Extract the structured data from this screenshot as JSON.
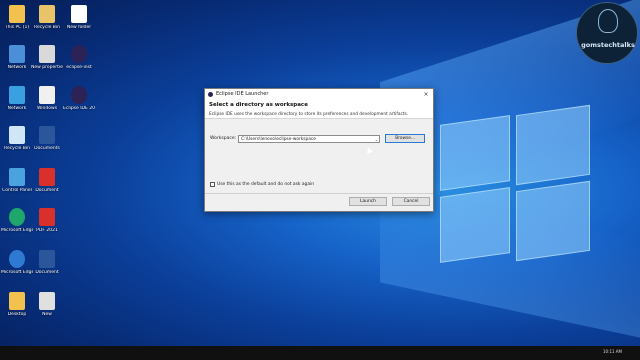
{
  "desktop": {
    "icons": [
      {
        "label": "This PC (1)",
        "color": "#f2c14e"
      },
      {
        "label": "Recycle Bin",
        "color": "#e8c36a"
      },
      {
        "label": "New folder",
        "color": "#ffffff"
      },
      {
        "label": "Network",
        "color": "#4a8fd8"
      },
      {
        "label": "New properties",
        "color": "#d9d9d9"
      },
      {
        "label": "eclipse-inst",
        "color": "#2c2255"
      },
      {
        "label": "Network",
        "color": "#3aa0e0"
      },
      {
        "label": "Windows",
        "color": "#f0f0f0"
      },
      {
        "label": "Eclipse IDE 2021-03",
        "color": "#2c2255"
      },
      {
        "label": "Recycle Bin",
        "color": "#cfe6f7"
      },
      {
        "label": "Documents",
        "color": "#2b579a"
      },
      {
        "label": "Control Panel",
        "color": "#4aa3df"
      },
      {
        "label": "Document",
        "color": "#d9302c"
      },
      {
        "label": "Microsoft Edge",
        "color": "#1fa66a"
      },
      {
        "label": "PDF 2021",
        "color": "#d9302c"
      },
      {
        "label": "Microsoft Edge",
        "color": "#2f7ad1"
      },
      {
        "label": "Document",
        "color": "#2b579a"
      },
      {
        "label": "Desktop",
        "color": "#f2c14e"
      },
      {
        "label": "New",
        "color": "#e0e0e0"
      }
    ]
  },
  "watermark": {
    "text": "gomstechtalks"
  },
  "dialog": {
    "window_title": "Eclipse IDE Launcher",
    "close_glyph": "×",
    "heading": "Select a directory as workspace",
    "description": "Eclipse IDE uses the workspace directory to store its preferences and development artifacts.",
    "workspace_label": "Workspace:",
    "workspace_value": "C:\\Users\\lenovo\\eclipse-workspace",
    "combo_arrow": "⌄",
    "browse_label": "Browse...",
    "checkbox_label": "Use this as the default and do not ask again",
    "checkbox_checked": false,
    "launch_label": "Launch",
    "cancel_label": "Cancel"
  },
  "taskbar": {
    "time": "10:11 AM"
  }
}
